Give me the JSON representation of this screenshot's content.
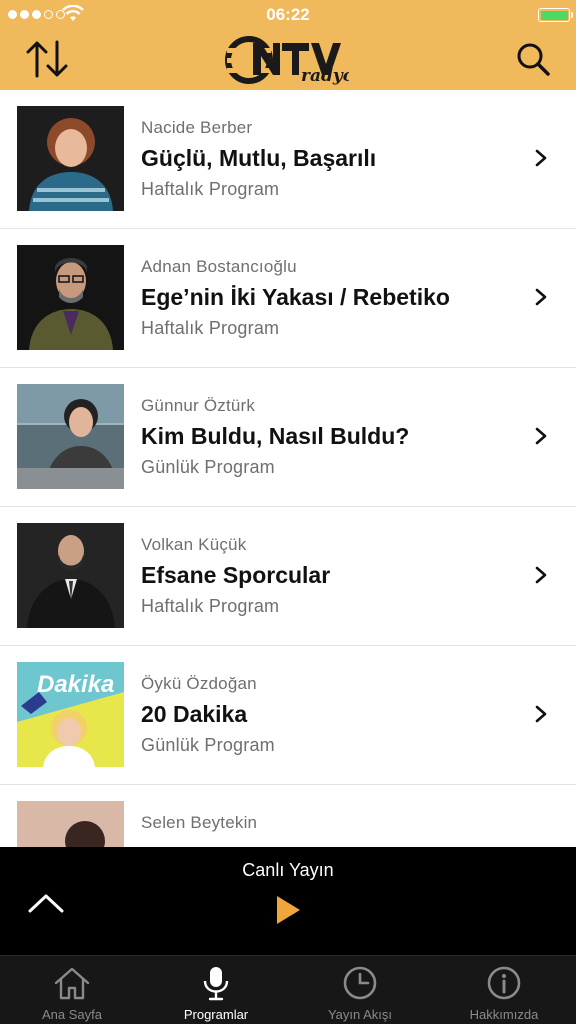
{
  "status_bar": {
    "time": "06:22",
    "signal_bars": 3,
    "battery_level": 1.0
  },
  "header": {
    "brand": "NTV radyo",
    "background": "#f0b95b"
  },
  "programs": [
    {
      "host": "Nacide Berber",
      "title": "Güçlü, Mutlu, Başarılı",
      "kind": "Haftalık Program"
    },
    {
      "host": "Adnan Bostancıoğlu",
      "title": "Ege’nin İki Yakası / Rebetiko",
      "kind": "Haftalık Program"
    },
    {
      "host": "Günnur Öztürk",
      "title": "Kim Buldu, Nasıl Buldu?",
      "kind": "Günlük Program"
    },
    {
      "host": "Volkan Küçük",
      "title": "Efsane Sporcular",
      "kind": "Haftalık Program"
    },
    {
      "host": "Öykü Özdoğan",
      "title": "20 Dakika",
      "kind": "Günlük Program"
    },
    {
      "host": "Selen Beytekin",
      "title": "",
      "kind": ""
    }
  ],
  "player": {
    "label": "Canlı Yayın",
    "accent": "#f0a63a"
  },
  "tabs": [
    {
      "label": "Ana Sayfa",
      "icon": "home-icon",
      "active": false
    },
    {
      "label": "Programlar",
      "icon": "microphone-icon",
      "active": true
    },
    {
      "label": "Yayın Akışı",
      "icon": "clock-icon",
      "active": false
    },
    {
      "label": "Hakkımızda",
      "icon": "info-icon",
      "active": false
    }
  ]
}
